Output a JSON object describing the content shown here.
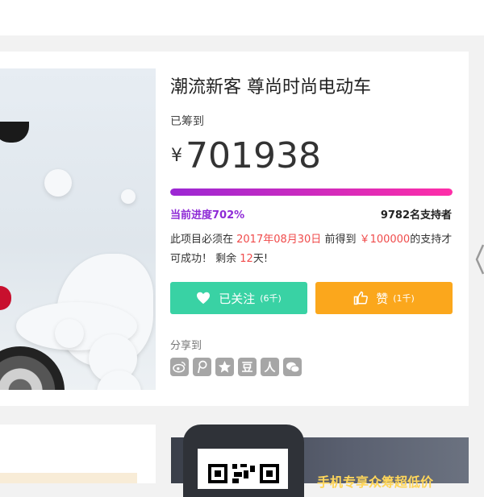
{
  "project": {
    "title": "潮流新客 尊尚时尚电动车",
    "raised_label": "已筹到",
    "currency": "¥",
    "amount": "701938",
    "progress_label": "当前进度702%",
    "progress_fraction": 1.0,
    "supporters": "9782名支持者",
    "notice": {
      "part1": "此项目必须在 ",
      "date": "2017年08月30日",
      "part2": " 前得到 ",
      "goal": "￥100000",
      "part3": "的支持才可成功！ 剩余 ",
      "days": "12",
      "part4": "天!"
    }
  },
  "actions": {
    "follow_label": "已关注",
    "follow_count": "(6千)",
    "like_label": "赞",
    "like_count": "(1千)"
  },
  "share": {
    "label": "分享到",
    "icons": [
      "weibo-icon",
      "tencent-weibo-icon",
      "qzone-icon",
      "douban-icon",
      "renren-icon",
      "wechat-icon"
    ],
    "douban_glyph": "豆",
    "renren_glyph": "人"
  },
  "banner": {
    "text": "手机专享众筹超低价"
  },
  "colors": {
    "follow_button": "#39d2a4",
    "like_button": "#fba71c",
    "progress_start": "#9b27d4",
    "progress_end": "#ff2ea8",
    "progress_text": "#8e2ad6",
    "highlight": "#f04b4b"
  }
}
